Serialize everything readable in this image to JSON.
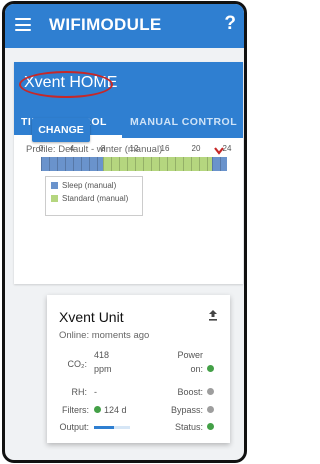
{
  "appbar": {
    "title": "WIFIMODULE",
    "help_label": "?"
  },
  "home": {
    "title": "Xvent HOME",
    "tabs": [
      {
        "label": "TIME CONTROL",
        "active": true
      },
      {
        "label": "MANUAL CONTROL",
        "active": false
      }
    ],
    "profile": "Profile: Default - winter (manual)",
    "change_label": "CHANGE",
    "timeline": {
      "ticks": [
        "0",
        "4",
        "8",
        "12",
        "16",
        "20",
        "24"
      ],
      "segments": [
        {
          "mode": "sleep",
          "from": 0,
          "to": 8
        },
        {
          "mode": "standard",
          "from": 8,
          "to": 22
        },
        {
          "mode": "sleep",
          "from": 22,
          "to": 24
        }
      ],
      "marker_icon": "chevron-down-icon"
    },
    "legend": [
      {
        "label": "Sleep (manual)",
        "color": "#6a93cc"
      },
      {
        "label": "Standard (manual)",
        "color": "#b5d67f"
      }
    ]
  },
  "unit": {
    "name": "Xvent Unit",
    "online": "Online: moments ago",
    "co2_label": "CO₂:",
    "co2_value": "418",
    "co2_unit": "ppm",
    "rh_label": "RH:",
    "rh_value": "-",
    "filters_label": "Filters:",
    "filters_value": "124 d",
    "output_label": "Output:",
    "output_level": 0.55,
    "power_label_1": "Power",
    "power_label_2": "on:",
    "boost_label": "Boost:",
    "bypass_label": "Bypass:",
    "status_label": "Status:",
    "colors": {
      "on": "#43a047",
      "off": "#9e9e9e"
    }
  }
}
